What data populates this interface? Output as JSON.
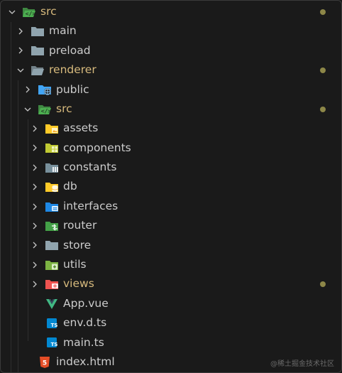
{
  "rows": [
    {
      "label": "src",
      "depth": 0,
      "kind": "folder-open",
      "icon": "code-folder-open-icon",
      "color": "#4caf50",
      "modified": true
    },
    {
      "label": "main",
      "depth": 1,
      "kind": "folder",
      "icon": "folder-icon",
      "color": "#90a4ae",
      "modified": false
    },
    {
      "label": "preload",
      "depth": 1,
      "kind": "folder",
      "icon": "folder-icon",
      "color": "#90a4ae",
      "modified": false
    },
    {
      "label": "renderer",
      "depth": 1,
      "kind": "folder-open",
      "icon": "folder-open-icon",
      "color": "#90a4ae",
      "modified": true
    },
    {
      "label": "public",
      "depth": 2,
      "kind": "folder",
      "icon": "public-folder-icon",
      "color": "#42a5f5",
      "modified": false
    },
    {
      "label": "src",
      "depth": 2,
      "kind": "folder-open",
      "icon": "code-folder-open-icon",
      "color": "#4caf50",
      "modified": true
    },
    {
      "label": "assets",
      "depth": 3,
      "kind": "folder",
      "icon": "assets-folder-icon",
      "color": "#ffca28",
      "modified": false
    },
    {
      "label": "components",
      "depth": 3,
      "kind": "folder",
      "icon": "components-folder-icon",
      "color": "#c0ca33",
      "modified": false
    },
    {
      "label": "constants",
      "depth": 3,
      "kind": "folder",
      "icon": "constants-folder-icon",
      "color": "#78909c",
      "modified": false
    },
    {
      "label": "db",
      "depth": 3,
      "kind": "folder",
      "icon": "database-folder-icon",
      "color": "#ffca28",
      "modified": false
    },
    {
      "label": "interfaces",
      "depth": 3,
      "kind": "folder",
      "icon": "interfaces-folder-icon",
      "color": "#1e88e5",
      "modified": false
    },
    {
      "label": "router",
      "depth": 3,
      "kind": "folder",
      "icon": "router-folder-icon",
      "color": "#43a047",
      "modified": false
    },
    {
      "label": "store",
      "depth": 3,
      "kind": "folder",
      "icon": "folder-icon",
      "color": "#90a4ae",
      "modified": false
    },
    {
      "label": "utils",
      "depth": 3,
      "kind": "folder",
      "icon": "utils-folder-icon",
      "color": "#7cb342",
      "modified": false
    },
    {
      "label": "views",
      "depth": 3,
      "kind": "folder",
      "icon": "views-folder-icon",
      "color": "#ef5350",
      "modified": true
    },
    {
      "label": "App.vue",
      "depth": 3,
      "kind": "file",
      "icon": "vue-file-icon",
      "color": "#41b883",
      "modified": false
    },
    {
      "label": "env.d.ts",
      "depth": 3,
      "kind": "file",
      "icon": "typescript-file-icon",
      "color": "#0288d1",
      "modified": false
    },
    {
      "label": "main.ts",
      "depth": 3,
      "kind": "file",
      "icon": "typescript-file-icon",
      "color": "#0288d1",
      "modified": false
    },
    {
      "label": "index.html",
      "depth": 2,
      "kind": "file",
      "icon": "html-file-icon",
      "color": "#e44d26",
      "modified": false
    }
  ],
  "colors": {
    "modified_text": "#d7ba7d",
    "modified_dot": "#8d8748"
  },
  "watermark": "@稀土掘金技术社区"
}
